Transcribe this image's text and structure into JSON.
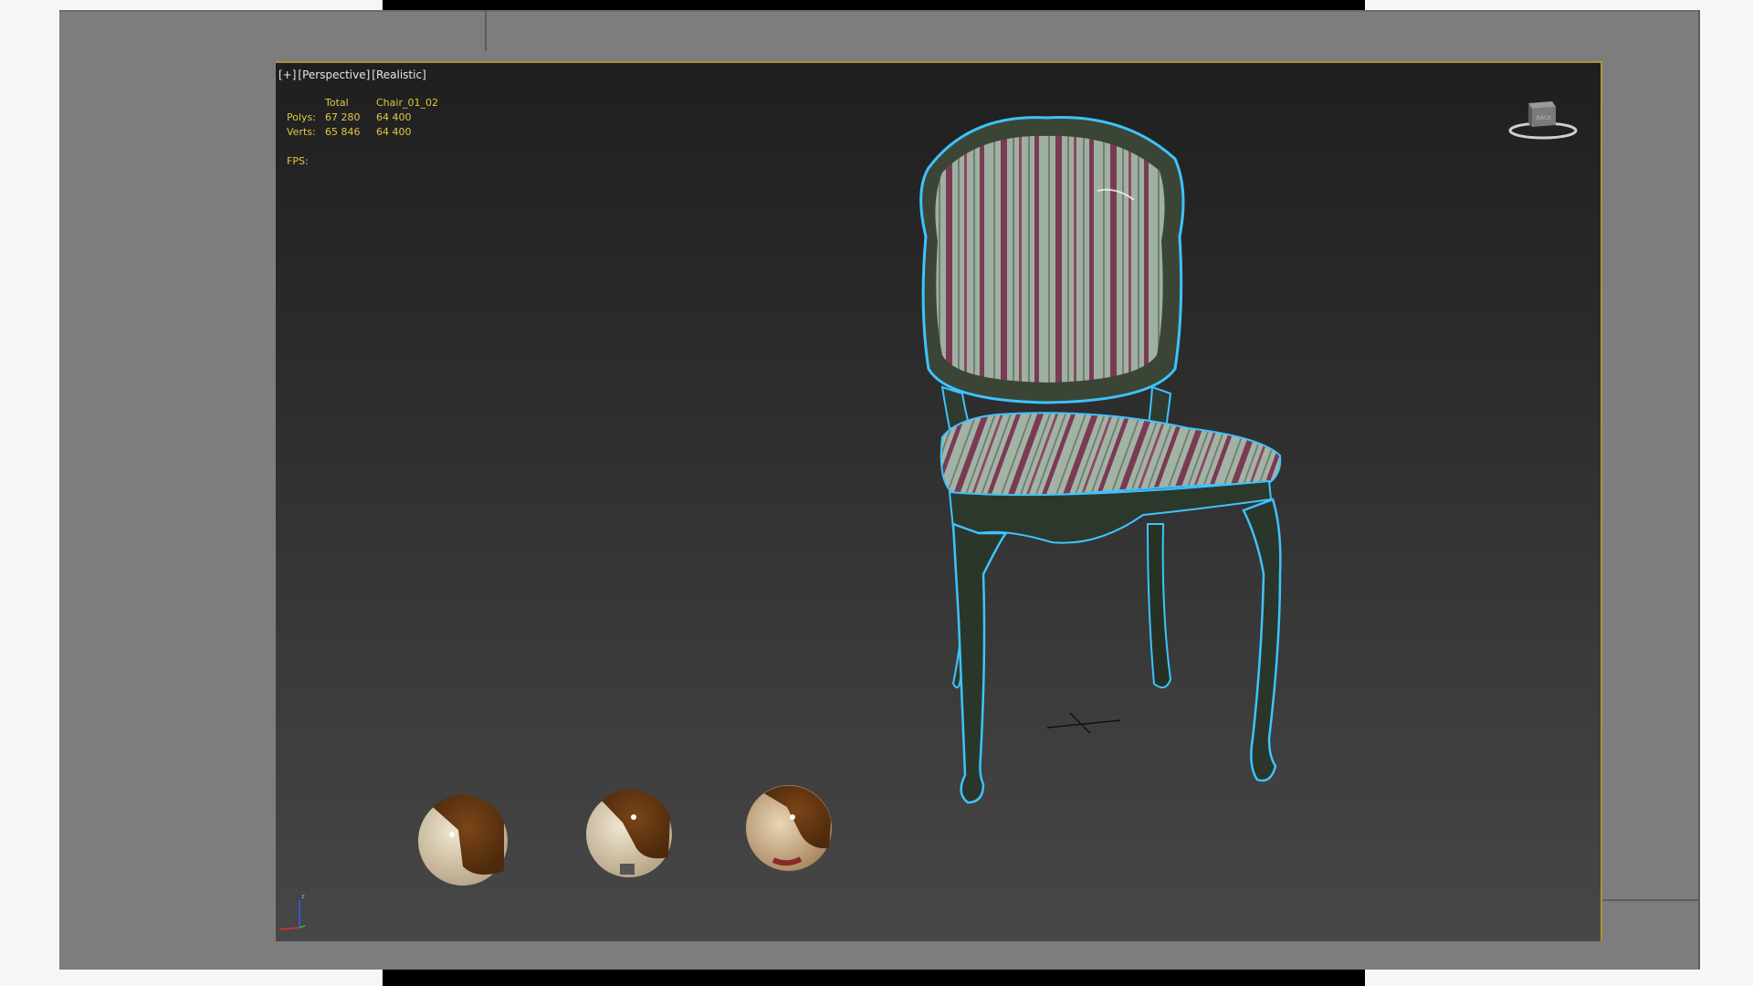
{
  "viewport": {
    "label_plus": "[+]",
    "label_view": "[Perspective]",
    "label_shading": "[Realistic]"
  },
  "stats": {
    "header_total": "Total",
    "header_object": "Chair_01_02",
    "polys_label": "Polys:",
    "polys_total": "67 280",
    "polys_object": "64 400",
    "verts_label": "Verts:",
    "verts_total": "65 846",
    "verts_object": "64 400",
    "fps_label": "FPS:"
  },
  "viewcube": {
    "face_label": "BACK"
  },
  "axis": {
    "z_label": "z"
  },
  "colors": {
    "accent_border": "#b0913a",
    "stats_text": "#e0c843",
    "selection_outline": "#3ec3ff"
  }
}
